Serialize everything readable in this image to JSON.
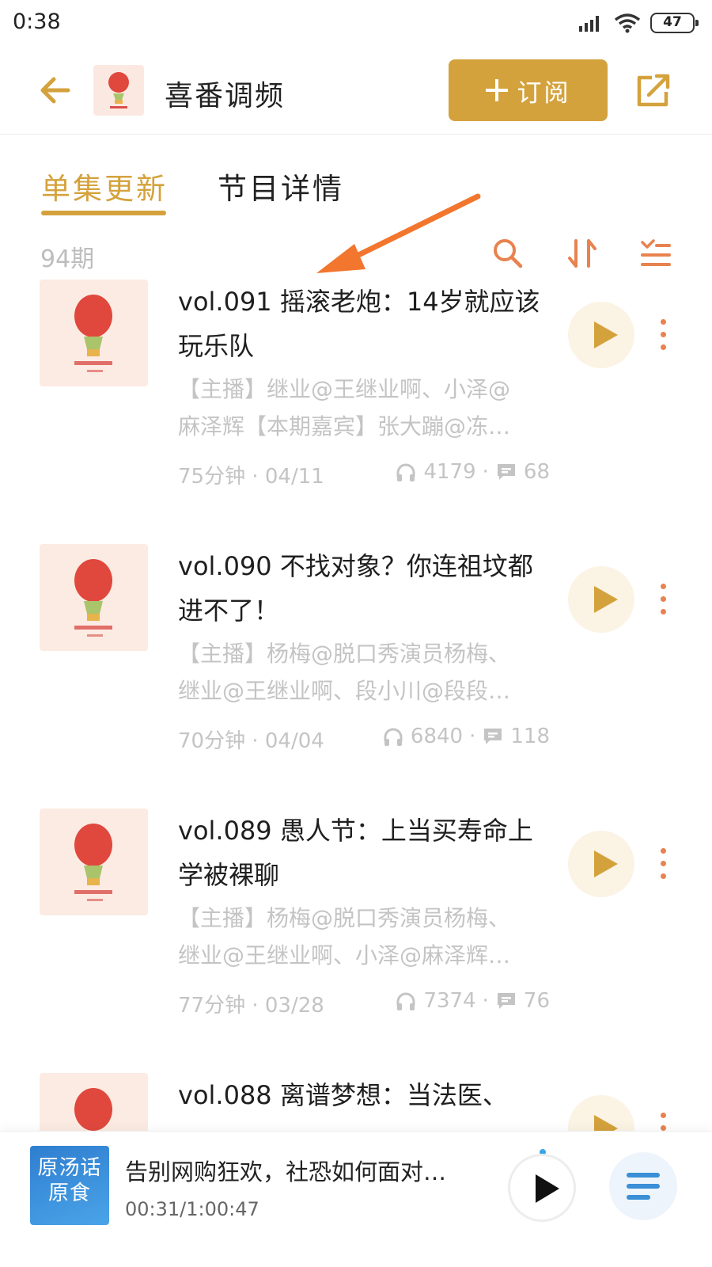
{
  "status_bar": {
    "time": "0:38",
    "battery": "47"
  },
  "header": {
    "title": "喜番调频",
    "subscribe_label": "订阅"
  },
  "tabs": [
    {
      "label": "单集更新",
      "active": true
    },
    {
      "label": "节目详情",
      "active": false
    }
  ],
  "episode_count": "94期",
  "episodes": [
    {
      "title": "vol.091 摇滚老炮：14岁就应该玩乐队",
      "desc_line1": "【主播】继业@王继业啊、小泽@",
      "desc_line2": "麻泽辉【本期嘉宾】张大蹦@冻…",
      "duration_date": "75分钟 · 04/11",
      "plays": "4179",
      "comments": "68"
    },
    {
      "title": "vol.090 不找对象？你连祖坟都进不了！",
      "desc_line1": "【主播】杨梅@脱口秀演员杨梅、",
      "desc_line2": "继业@王继业啊、段小川@段段…",
      "duration_date": "70分钟 · 04/04",
      "plays": "6840",
      "comments": "118"
    },
    {
      "title": "vol.089 愚人节：上当买寿命上学被裸聊",
      "desc_line1": "【主播】杨梅@脱口秀演员杨梅、",
      "desc_line2": "继业@王继业啊、小泽@麻泽辉…",
      "duration_date": "77分钟 · 03/28",
      "plays": "7374",
      "comments": "76"
    },
    {
      "title": "vol.088 离谱梦想：当法医、",
      "desc_line1": "",
      "desc_line2": "",
      "duration_date": "",
      "plays": "",
      "comments": ""
    }
  ],
  "player": {
    "cover_text": "原汤话原食",
    "title": "告别网购狂欢，社恐如何面对…",
    "time": "00:31/1:00:47"
  },
  "colors": {
    "accent": "#d4a23c",
    "orange": "#e8824f",
    "annotation": "#f2762e"
  }
}
